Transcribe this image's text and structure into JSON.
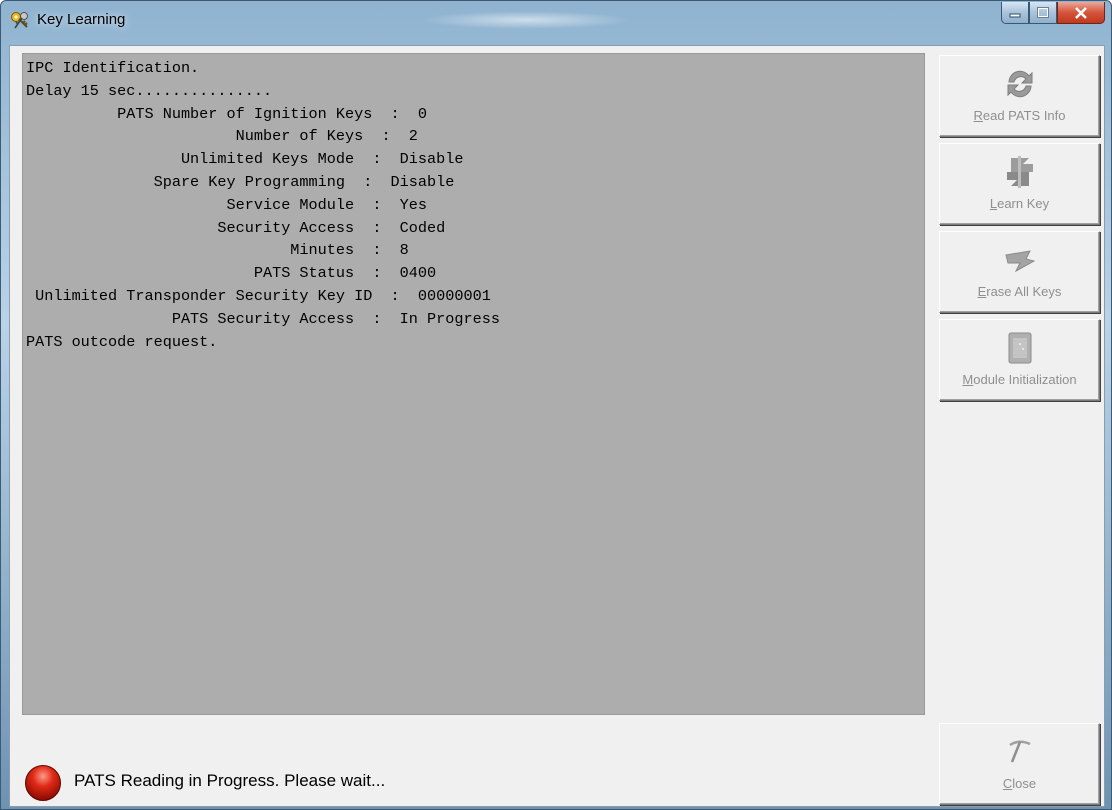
{
  "window": {
    "title": "Key Learning",
    "controls": [
      "minimize-icon",
      "maximize-icon",
      "close-icon"
    ]
  },
  "console": {
    "lines": [
      "IPC Identification.",
      "Delay 15 sec...............",
      "          PATS Number of Ignition Keys  :  0",
      "                       Number of Keys  :  2",
      "                 Unlimited Keys Mode  :  Disable",
      "              Spare Key Programming  :  Disable",
      "                      Service Module  :  Yes",
      "                     Security Access  :  Coded",
      "                             Minutes  :  8",
      "                         PATS Status  :  0400",
      " Unlimited Transponder Security Key ID  :  00000001",
      "                PATS Security Access  :  In Progress",
      "PATS outcode request."
    ]
  },
  "sidebar": {
    "buttons": [
      {
        "label": "Read PATS Info",
        "mnemonic": "R",
        "icon": "refresh-arrows-icon",
        "enabled": false
      },
      {
        "label": "Learn Key",
        "mnemonic": "L",
        "icon": "key-arrows-icon",
        "enabled": false
      },
      {
        "label": "Erase All Keys",
        "mnemonic": "E",
        "icon": "eraser-icon",
        "enabled": false
      },
      {
        "label": "Module Initialization",
        "mnemonic": "M",
        "icon": "module-chip-icon",
        "enabled": false
      },
      {
        "label": "Close",
        "mnemonic": "C",
        "icon": "pickaxe-icon",
        "enabled": false
      }
    ]
  },
  "status": {
    "text": "PATS Reading in Progress. Please wait...",
    "indicator": "red-led-icon"
  },
  "colors": {
    "console_bg": "#adadad",
    "disabled_text": "#8f8f8f",
    "led": "#e02a17"
  }
}
